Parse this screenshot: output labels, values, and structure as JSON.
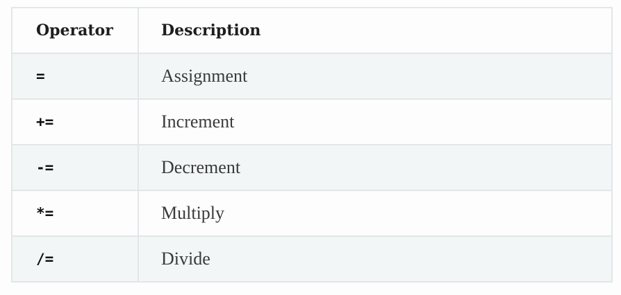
{
  "table": {
    "headers": {
      "operator": "Operator",
      "description": "Description"
    },
    "rows": [
      {
        "operator": "=",
        "description": "Assignment"
      },
      {
        "operator": "+=",
        "description": "Increment"
      },
      {
        "operator": "-=",
        "description": "Decrement"
      },
      {
        "operator": "*=",
        "description": "Multiply"
      },
      {
        "operator": "/=",
        "description": "Divide"
      }
    ]
  }
}
